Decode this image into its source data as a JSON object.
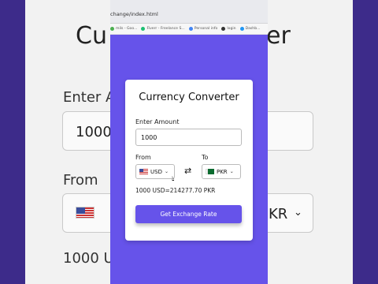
{
  "browser": {
    "url": "change/index.html",
    "bookmarks": [
      {
        "label": "mils - Goo...",
        "color": "#4caf50"
      },
      {
        "label": "Fiverr - Freelance S...",
        "color": "#1dbf73"
      },
      {
        "label": "Personal info",
        "color": "#4285f4"
      },
      {
        "label": "login",
        "color": "#333"
      },
      {
        "label": "Dashb...",
        "color": "#2196f3"
      }
    ]
  },
  "background": {
    "title_left": "Cu",
    "title_right": "er",
    "label_amount": "Enter A",
    "value_amount": "1000",
    "label_from": "From",
    "select_right": "KR",
    "result_partial": "1000 US"
  },
  "card": {
    "title": "Currency Converter",
    "amount_label": "Enter Amount",
    "amount_value": "1000",
    "from_label": "From",
    "to_label": "To",
    "from_currency": "USD",
    "to_currency": "PKR",
    "swap_icon": "⇄",
    "result": "1000 USD=214277.70 PKR",
    "button_label": "Get Exchange Rate"
  },
  "colors": {
    "accent": "#6653ea",
    "frame": "#3b2a82"
  }
}
